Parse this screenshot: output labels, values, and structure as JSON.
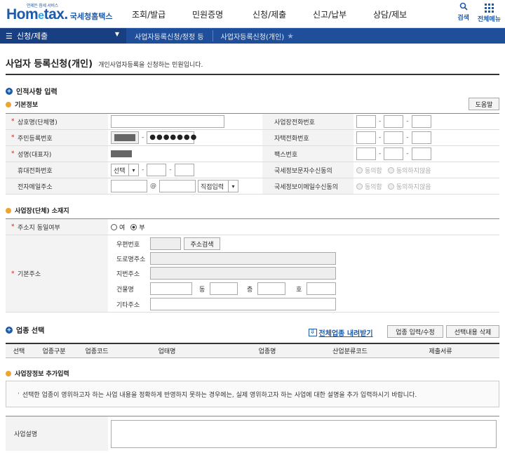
{
  "header": {
    "logo_main_a": "Hom",
    "logo_main_e": "e",
    "logo_main_b": "tax.",
    "logo_tag": "언제든 참세 서비스",
    "logo_sub": "국세청홈택스",
    "gnb": [
      "조회/발급",
      "민원증명",
      "신청/제출",
      "신고/납부",
      "상담/제보"
    ],
    "tools": {
      "search": "검색",
      "allmenu": "전체메뉴"
    }
  },
  "nav": {
    "menu": "신청/제출",
    "crumbs": [
      "사업자등록신청/정정 등",
      "사업자등록신청(개인)"
    ]
  },
  "page": {
    "title": "사업자 등록신청(개인)",
    "desc": "개인사업자등록을 신청하는 민원입니다."
  },
  "section1": {
    "title": "인적사항 입력",
    "sub": "기본정보",
    "help_button": "도움말",
    "rows": {
      "company": "상호명(단체명)",
      "rrn": "주민등록번호",
      "rrn_masked": "●●●●●●●",
      "name": "성명(대표자)",
      "mobile": "휴대전화번호",
      "mobile_select": "선택",
      "email": "전자메일주소",
      "email_at": "@",
      "email_domain": "직접입력",
      "biz_phone": "사업장전화번호",
      "home_phone": "자택전화번호",
      "fax": "팩스번호",
      "sms_consent": "국세정보문자수신동의",
      "mail_consent": "국세정보이메일수신동의",
      "agree": "동의함",
      "disagree": "동의하지않음"
    }
  },
  "section2": {
    "sub": "사업장(단체) 소재지",
    "same_addr": "주소지 동일여부",
    "yes": "여",
    "no": "부",
    "base_addr": "기본주소",
    "postal": "우편번호",
    "addr_search": "주소검색",
    "road": "도로명주소",
    "lot": "지번주소",
    "building": "건물명",
    "dong": "동",
    "floor": "층",
    "ho": "호",
    "other": "기타주소"
  },
  "section3": {
    "title": "업종 선택",
    "download": "전체업종 내려받기",
    "edit_button": "업종 입력/수정",
    "delete_button": "선택내용 삭제",
    "columns": [
      "선택",
      "업종구분",
      "업종코드",
      "업태명",
      "업종명",
      "산업분류코드",
      "제출서류"
    ]
  },
  "section4": {
    "sub": "사업장정보 추가입력",
    "notice": "선택한 업종이 영위하고자 하는 사업 내용을 정확하게 반영하지 못하는 경우에는, 실제 영위하고자 하는 사업에 대한 설명을 추가 입력하시기 바랍니다.",
    "biz_desc": "사업설명"
  }
}
